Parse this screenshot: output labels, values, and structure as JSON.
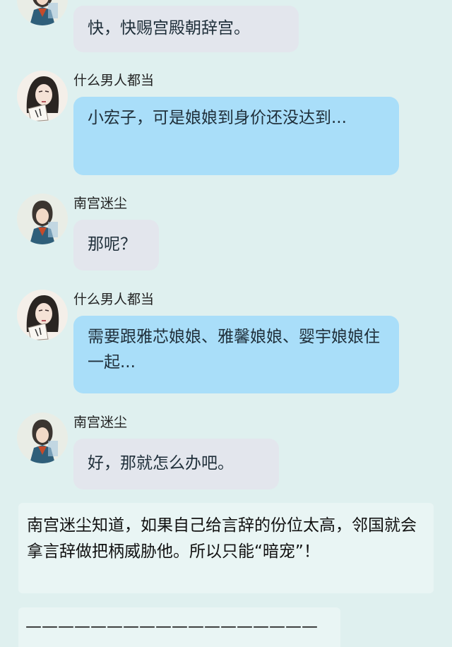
{
  "messages": [
    {
      "sender": "",
      "avatar": "nangong-avatar",
      "style": "grey",
      "text": "快，快赐宫殿朝辞宫。"
    },
    {
      "sender": "什么男人都当",
      "avatar": "shenme-avatar",
      "style": "blue",
      "text": "小宏子，可是娘娘到身价还没达到..."
    },
    {
      "sender": "南宫迷尘",
      "avatar": "nangong-avatar",
      "style": "grey",
      "text": "那呢？"
    },
    {
      "sender": "什么男人都当",
      "avatar": "shenme-avatar",
      "style": "blue",
      "text": "需要跟雅芯娘娘、雅馨娘娘、婴宇娘娘住一起..."
    },
    {
      "sender": "南宫迷尘",
      "avatar": "nangong-avatar",
      "style": "grey",
      "text": "好，那就怎么办吧。"
    }
  ],
  "narration": "南宫迷尘知道，如果自己给言辞的份位太高，邻国就会拿言辞做把柄威胁他。所以只能“暗宠”！",
  "divider": "——————————————————",
  "colors": {
    "background": "#dff0ef",
    "blue_bubble": "#a9def9",
    "grey_bubble": "#e3e6ed",
    "narration_bg": "#e9f5f4"
  }
}
